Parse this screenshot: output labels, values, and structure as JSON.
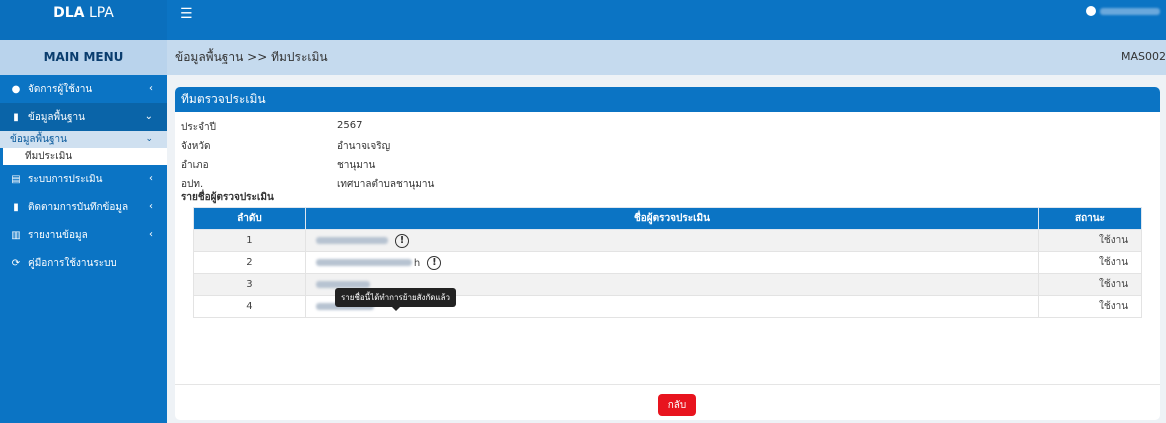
{
  "app": {
    "brand_bold": "DLA",
    "brand_light": " LPA"
  },
  "topbar": {
    "menu_icon": "☰"
  },
  "sidebar": {
    "header": "MAIN MENU",
    "items": [
      {
        "icon": "user-icon",
        "glyph": "👤",
        "label": "จัดการผู้ใช้งาน",
        "chevron": "‹"
      },
      {
        "icon": "book-icon",
        "glyph": "▮",
        "label": "ข้อมูลพื้นฐาน",
        "chevron": "⌄"
      },
      {
        "icon": "file-icon",
        "glyph": "▤",
        "label": "ระบบการประเมิน",
        "chevron": "‹"
      },
      {
        "icon": "clipboard-icon",
        "glyph": "▮",
        "label": "ติดตามการบันทึกข้อมูล",
        "chevron": "‹"
      },
      {
        "icon": "chart-icon",
        "glyph": "▥",
        "label": "รายงานข้อมูล",
        "chevron": "‹"
      },
      {
        "icon": "manual-icon",
        "glyph": "⟳",
        "label": "คู่มือการใช้งานระบบ",
        "chevron": ""
      }
    ],
    "sub_label": "ข้อมูลพื้นฐาน",
    "sub_sub_label": "ทีมประเมิน"
  },
  "breadcrumb": {
    "text": "ข้อมูลพื้นฐาน >> ทีมประเมิน",
    "code": "MAS002"
  },
  "card": {
    "title": "ทีมตรวจประเมิน",
    "info": [
      {
        "label": "ประจำปี",
        "value": "2567"
      },
      {
        "label": "จังหวัด",
        "value": "อำนาจเจริญ"
      },
      {
        "label": "อำเภอ",
        "value": "ชานุมาน"
      },
      {
        "label": "อปท.",
        "value": "เทศบาลตำบลชานุมาน"
      }
    ],
    "section_label": "รายชื่อผู้ตรวจประเมิน",
    "table": {
      "headers": [
        "ลำดับ",
        "ชื่อผู้ตรวจประเมิน",
        "สถานะ"
      ],
      "rows": [
        {
          "num": "1",
          "suffix": "",
          "warn": true,
          "status": "ใช้งาน"
        },
        {
          "num": "2",
          "suffix": "h",
          "warn": true,
          "status": "ใช้งาน"
        },
        {
          "num": "3",
          "suffix": "",
          "warn": false,
          "status": "ใช้งาน"
        },
        {
          "num": "4",
          "suffix": "",
          "warn": false,
          "status": "ใช้งาน"
        }
      ]
    },
    "tooltip": "รายชื่อนี้ได้ทำการย้ายสังกัดแล้ว",
    "back_button": "กลับ"
  }
}
